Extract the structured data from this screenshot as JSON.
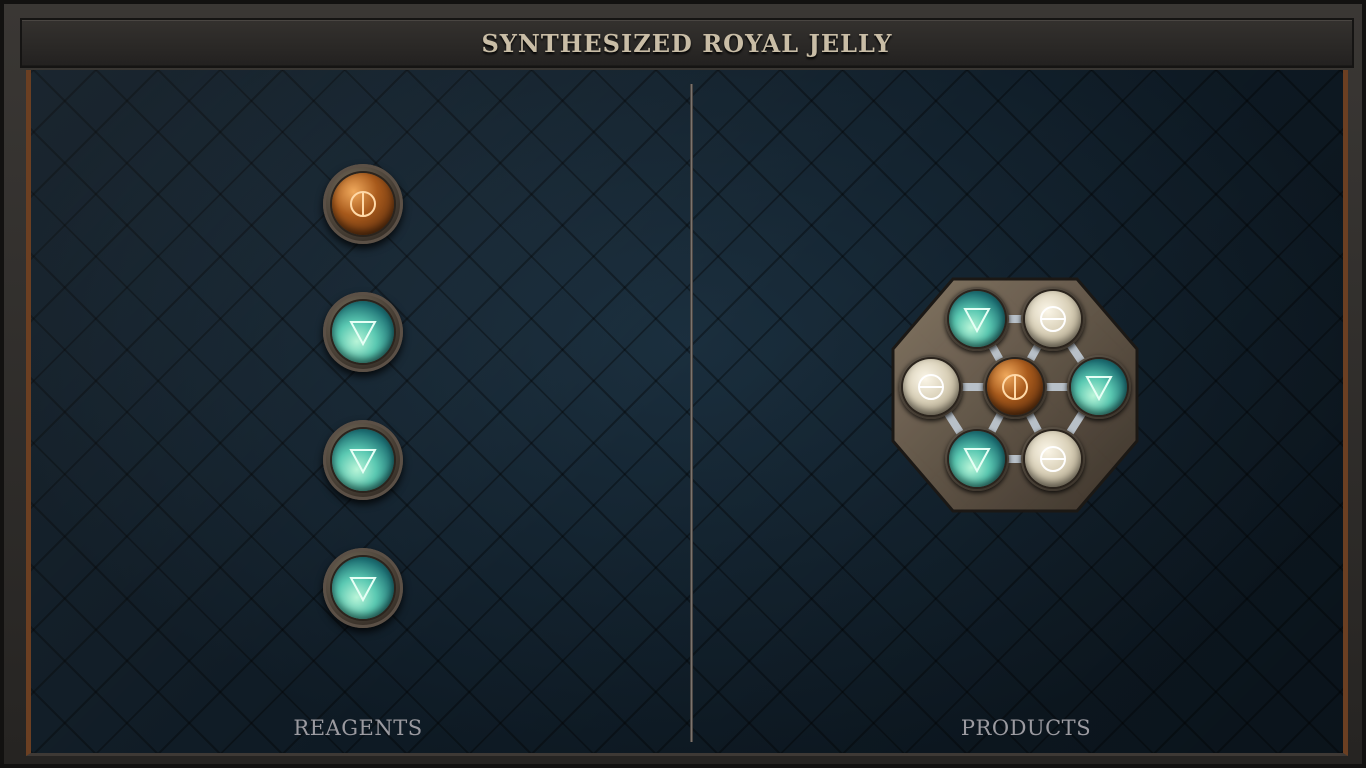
{
  "title": "SYNTHESIZED ROYAL JELLY",
  "labels": {
    "reagents": "REAGENTS",
    "products": "PRODUCTS"
  },
  "reagents": [
    {
      "element": "salt-copper",
      "icon": "salt-symbol-icon"
    },
    {
      "element": "water",
      "icon": "water-triangle-icon"
    },
    {
      "element": "water",
      "icon": "water-triangle-icon"
    },
    {
      "element": "water",
      "icon": "water-triangle-icon"
    }
  ],
  "products": {
    "molecule": [
      {
        "element": "water",
        "icon": "water-triangle-icon"
      },
      {
        "element": "salt",
        "icon": "salt-symbol-icon"
      },
      {
        "element": "salt",
        "icon": "salt-symbol-icon"
      },
      {
        "element": "copper",
        "icon": "salt-symbol-icon"
      },
      {
        "element": "water",
        "icon": "water-triangle-icon"
      },
      {
        "element": "water",
        "icon": "water-triangle-icon"
      },
      {
        "element": "salt",
        "icon": "salt-symbol-icon"
      }
    ]
  },
  "colors": {
    "frame": "#262422",
    "board": "#0f1c27",
    "accent_copper": "#6b3f22",
    "title_text": "#c9bda6",
    "label_text": "#9b9aa0"
  }
}
